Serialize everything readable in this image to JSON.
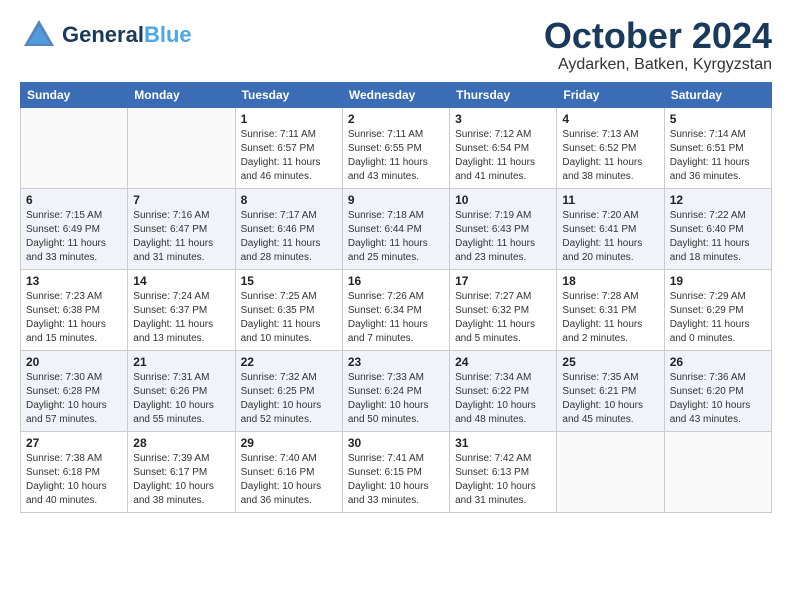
{
  "logo": {
    "line1": "General",
    "line2": "Blue",
    "tagline": ""
  },
  "title": "October 2024",
  "location": "Aydarken, Batken, Kyrgyzstan",
  "headers": [
    "Sunday",
    "Monday",
    "Tuesday",
    "Wednesday",
    "Thursday",
    "Friday",
    "Saturday"
  ],
  "weeks": [
    [
      {
        "day": "",
        "sunrise": "",
        "sunset": "",
        "daylight": ""
      },
      {
        "day": "",
        "sunrise": "",
        "sunset": "",
        "daylight": ""
      },
      {
        "day": "1",
        "sunrise": "Sunrise: 7:11 AM",
        "sunset": "Sunset: 6:57 PM",
        "daylight": "Daylight: 11 hours and 46 minutes."
      },
      {
        "day": "2",
        "sunrise": "Sunrise: 7:11 AM",
        "sunset": "Sunset: 6:55 PM",
        "daylight": "Daylight: 11 hours and 43 minutes."
      },
      {
        "day": "3",
        "sunrise": "Sunrise: 7:12 AM",
        "sunset": "Sunset: 6:54 PM",
        "daylight": "Daylight: 11 hours and 41 minutes."
      },
      {
        "day": "4",
        "sunrise": "Sunrise: 7:13 AM",
        "sunset": "Sunset: 6:52 PM",
        "daylight": "Daylight: 11 hours and 38 minutes."
      },
      {
        "day": "5",
        "sunrise": "Sunrise: 7:14 AM",
        "sunset": "Sunset: 6:51 PM",
        "daylight": "Daylight: 11 hours and 36 minutes."
      }
    ],
    [
      {
        "day": "6",
        "sunrise": "Sunrise: 7:15 AM",
        "sunset": "Sunset: 6:49 PM",
        "daylight": "Daylight: 11 hours and 33 minutes."
      },
      {
        "day": "7",
        "sunrise": "Sunrise: 7:16 AM",
        "sunset": "Sunset: 6:47 PM",
        "daylight": "Daylight: 11 hours and 31 minutes."
      },
      {
        "day": "8",
        "sunrise": "Sunrise: 7:17 AM",
        "sunset": "Sunset: 6:46 PM",
        "daylight": "Daylight: 11 hours and 28 minutes."
      },
      {
        "day": "9",
        "sunrise": "Sunrise: 7:18 AM",
        "sunset": "Sunset: 6:44 PM",
        "daylight": "Daylight: 11 hours and 25 minutes."
      },
      {
        "day": "10",
        "sunrise": "Sunrise: 7:19 AM",
        "sunset": "Sunset: 6:43 PM",
        "daylight": "Daylight: 11 hours and 23 minutes."
      },
      {
        "day": "11",
        "sunrise": "Sunrise: 7:20 AM",
        "sunset": "Sunset: 6:41 PM",
        "daylight": "Daylight: 11 hours and 20 minutes."
      },
      {
        "day": "12",
        "sunrise": "Sunrise: 7:22 AM",
        "sunset": "Sunset: 6:40 PM",
        "daylight": "Daylight: 11 hours and 18 minutes."
      }
    ],
    [
      {
        "day": "13",
        "sunrise": "Sunrise: 7:23 AM",
        "sunset": "Sunset: 6:38 PM",
        "daylight": "Daylight: 11 hours and 15 minutes."
      },
      {
        "day": "14",
        "sunrise": "Sunrise: 7:24 AM",
        "sunset": "Sunset: 6:37 PM",
        "daylight": "Daylight: 11 hours and 13 minutes."
      },
      {
        "day": "15",
        "sunrise": "Sunrise: 7:25 AM",
        "sunset": "Sunset: 6:35 PM",
        "daylight": "Daylight: 11 hours and 10 minutes."
      },
      {
        "day": "16",
        "sunrise": "Sunrise: 7:26 AM",
        "sunset": "Sunset: 6:34 PM",
        "daylight": "Daylight: 11 hours and 7 minutes."
      },
      {
        "day": "17",
        "sunrise": "Sunrise: 7:27 AM",
        "sunset": "Sunset: 6:32 PM",
        "daylight": "Daylight: 11 hours and 5 minutes."
      },
      {
        "day": "18",
        "sunrise": "Sunrise: 7:28 AM",
        "sunset": "Sunset: 6:31 PM",
        "daylight": "Daylight: 11 hours and 2 minutes."
      },
      {
        "day": "19",
        "sunrise": "Sunrise: 7:29 AM",
        "sunset": "Sunset: 6:29 PM",
        "daylight": "Daylight: 11 hours and 0 minutes."
      }
    ],
    [
      {
        "day": "20",
        "sunrise": "Sunrise: 7:30 AM",
        "sunset": "Sunset: 6:28 PM",
        "daylight": "Daylight: 10 hours and 57 minutes."
      },
      {
        "day": "21",
        "sunrise": "Sunrise: 7:31 AM",
        "sunset": "Sunset: 6:26 PM",
        "daylight": "Daylight: 10 hours and 55 minutes."
      },
      {
        "day": "22",
        "sunrise": "Sunrise: 7:32 AM",
        "sunset": "Sunset: 6:25 PM",
        "daylight": "Daylight: 10 hours and 52 minutes."
      },
      {
        "day": "23",
        "sunrise": "Sunrise: 7:33 AM",
        "sunset": "Sunset: 6:24 PM",
        "daylight": "Daylight: 10 hours and 50 minutes."
      },
      {
        "day": "24",
        "sunrise": "Sunrise: 7:34 AM",
        "sunset": "Sunset: 6:22 PM",
        "daylight": "Daylight: 10 hours and 48 minutes."
      },
      {
        "day": "25",
        "sunrise": "Sunrise: 7:35 AM",
        "sunset": "Sunset: 6:21 PM",
        "daylight": "Daylight: 10 hours and 45 minutes."
      },
      {
        "day": "26",
        "sunrise": "Sunrise: 7:36 AM",
        "sunset": "Sunset: 6:20 PM",
        "daylight": "Daylight: 10 hours and 43 minutes."
      }
    ],
    [
      {
        "day": "27",
        "sunrise": "Sunrise: 7:38 AM",
        "sunset": "Sunset: 6:18 PM",
        "daylight": "Daylight: 10 hours and 40 minutes."
      },
      {
        "day": "28",
        "sunrise": "Sunrise: 7:39 AM",
        "sunset": "Sunset: 6:17 PM",
        "daylight": "Daylight: 10 hours and 38 minutes."
      },
      {
        "day": "29",
        "sunrise": "Sunrise: 7:40 AM",
        "sunset": "Sunset: 6:16 PM",
        "daylight": "Daylight: 10 hours and 36 minutes."
      },
      {
        "day": "30",
        "sunrise": "Sunrise: 7:41 AM",
        "sunset": "Sunset: 6:15 PM",
        "daylight": "Daylight: 10 hours and 33 minutes."
      },
      {
        "day": "31",
        "sunrise": "Sunrise: 7:42 AM",
        "sunset": "Sunset: 6:13 PM",
        "daylight": "Daylight: 10 hours and 31 minutes."
      },
      {
        "day": "",
        "sunrise": "",
        "sunset": "",
        "daylight": ""
      },
      {
        "day": "",
        "sunrise": "",
        "sunset": "",
        "daylight": ""
      }
    ]
  ]
}
